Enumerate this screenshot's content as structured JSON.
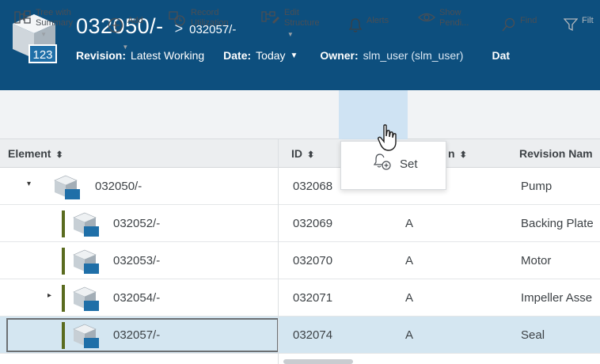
{
  "header": {
    "title": "032050/-",
    "breadcrumb_sep": ">",
    "breadcrumb_child": "032057/-",
    "icon": "part-cube-123-icon",
    "badge": "123",
    "revision_label": "Revision:",
    "revision_value": "Latest Working",
    "date_label": "Date:",
    "date_value": "Today",
    "owner_label": "Owner:",
    "owner_value": "slm_user (slm_user)",
    "truncated_label": "Dat"
  },
  "toolbar": {
    "tree_label_1": "Tree with",
    "tree_label_2": "Summary",
    "add_label": "Add",
    "record_label_1": "Record",
    "record_label_2": "Utilization",
    "edit_label_1": "Edit",
    "edit_label_2": "Structure",
    "alerts_label": "Alerts",
    "show_label_1": "Show",
    "show_label_2": "Pendi...",
    "find_label": "Find",
    "filter_label": "Filt"
  },
  "alerts_menu": {
    "items": [
      {
        "label": "Set",
        "icon": "bell-plus-icon"
      }
    ]
  },
  "table": {
    "columns": [
      "Element",
      "ID",
      "n",
      "Revision Nam"
    ],
    "rows": [
      {
        "element": "032050/-",
        "id": "032068",
        "rev": "",
        "name": "Pump",
        "expander": "▾"
      },
      {
        "element": "032052/-",
        "id": "032069",
        "rev": "A",
        "name": "Backing Plate",
        "expander": ""
      },
      {
        "element": "032053/-",
        "id": "032070",
        "rev": "A",
        "name": "Motor",
        "expander": ""
      },
      {
        "element": "032054/-",
        "id": "032071",
        "rev": "A",
        "name": "Impeller Asse",
        "expander": "▸"
      },
      {
        "element": "032057/-",
        "id": "032074",
        "rev": "A",
        "name": "Seal",
        "expander": ""
      }
    ]
  },
  "colors": {
    "header_bg": "#0d4f7e",
    "toolbar_bg": "#f1f3f5",
    "alerts_active": "#cfe3f3",
    "selected_row": "#d4e6f1",
    "structure_bar": "#5a6b1f"
  }
}
